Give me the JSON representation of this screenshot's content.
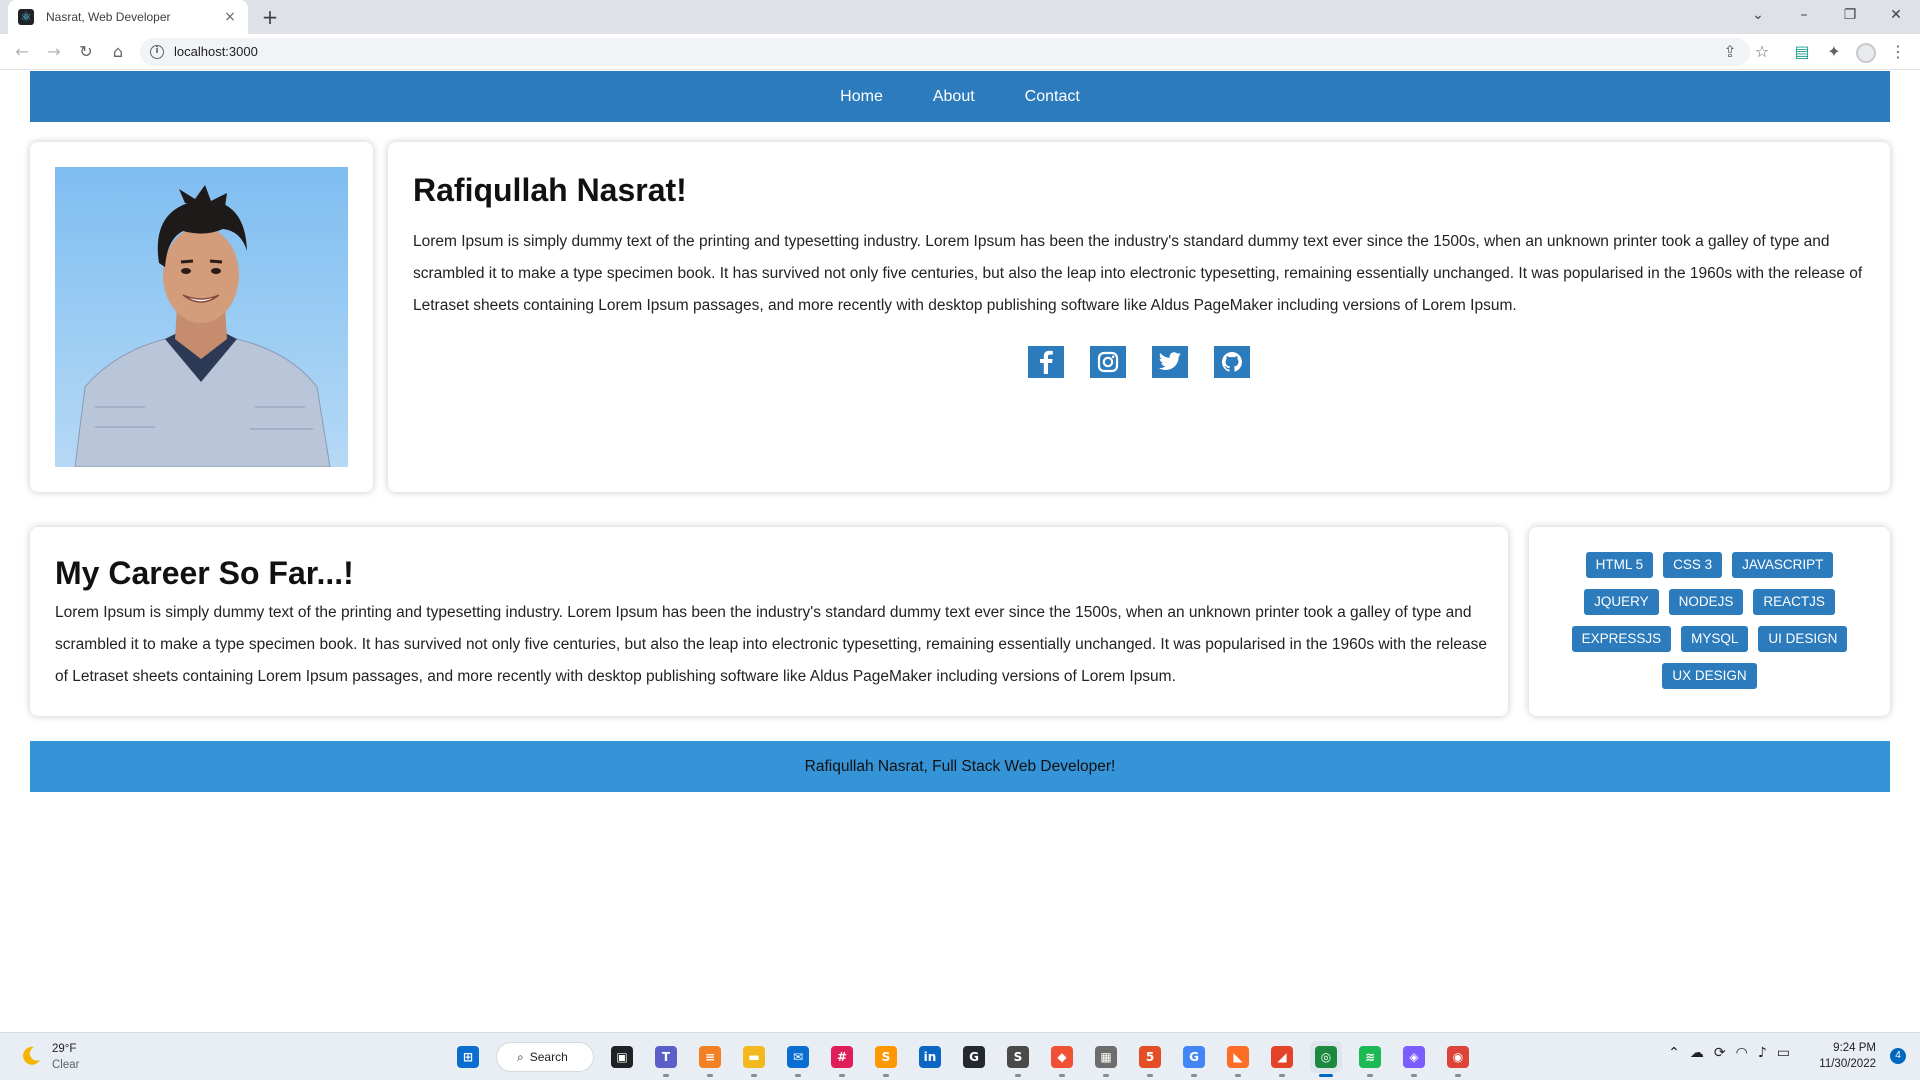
{
  "browser": {
    "tab_title": "Nasrat, Web Developer",
    "favicon_glyph": "⚛",
    "close_glyph": "×",
    "newtab_glyph": "+",
    "url": "localhost:3000",
    "window_controls": {
      "list": "⌄",
      "minimize": "–",
      "restore": "❐",
      "close": "✕"
    },
    "nav_glyphs": {
      "back": "←",
      "forward": "→",
      "reload": "↻",
      "home": "⌂",
      "info": "i",
      "share": "⇪",
      "star": "☆",
      "extensions": "✦",
      "menu": "⋮"
    }
  },
  "site": {
    "nav": [
      "Home",
      "About",
      "Contact"
    ],
    "name": "Rafiqullah Nasrat!",
    "bio": "Lorem Ipsum is simply dummy text of the printing and typesetting industry. Lorem Ipsum has been the industry's standard dummy text ever since the 1500s, when an unknown printer took a galley of type and scrambled it to make a type specimen book. It has survived not only five centuries, but also the leap into electronic typesetting, remaining essentially unchanged. It was popularised in the 1960s with the release of Letraset sheets containing Lorem Ipsum passages, and more recently with desktop publishing software like Aldus PageMaker including versions of Lorem Ipsum.",
    "socials": [
      "facebook-icon",
      "instagram-icon",
      "twitter-icon",
      "github-icon"
    ],
    "career_title": "My Career So Far...!",
    "career_text": "Lorem Ipsum is simply dummy text of the printing and typesetting industry. Lorem Ipsum has been the industry's standard dummy text ever since the 1500s, when an unknown printer took a galley of type and scrambled it to make a type specimen book. It has survived not only five centuries, but also the leap into electronic typesetting, remaining essentially unchanged. It was popularised in the 1960s with the release of Letraset sheets containing Lorem Ipsum passages, and more recently with desktop publishing software like Aldus PageMaker including versions of Lorem Ipsum.",
    "skills": [
      "HTML 5",
      "CSS 3",
      "JAVASCRIPT",
      "JQUERY",
      "NODEJS",
      "REACTJS",
      "EXPRESSJS",
      "MYSQL",
      "UI DESIGN",
      "UX DESIGN"
    ],
    "footer": "Rafiqullah Nasrat, Full Stack Web Developer!",
    "colors": {
      "nav": "#2b7bbd",
      "footer": "#3594d8",
      "skill_badge": "#2b7bbd"
    }
  },
  "taskbar": {
    "weather_temp": "29°F",
    "weather_cond": "Clear",
    "search_label": "Search",
    "search_glyph": "⌕",
    "tray_glyphs": [
      "⌃",
      "☁",
      "⟳",
      "◠",
      "♪",
      "▭"
    ],
    "time": "9:24 PM",
    "date": "11/30/2022",
    "notifications": "4",
    "apps": [
      {
        "name": "windows-start-icon",
        "color": "#0a6ed1",
        "glyph": "⊞"
      },
      {
        "name": "search",
        "color": "",
        "glyph": ""
      },
      {
        "name": "task-view-icon",
        "color": "#202124",
        "glyph": "▣"
      },
      {
        "name": "teams-icon",
        "color": "#5b5fc7",
        "glyph": "T"
      },
      {
        "name": "stackoverflow-icon",
        "color": "#f48024",
        "glyph": "≡"
      },
      {
        "name": "file-explorer-icon",
        "color": "#f2b81e",
        "glyph": "▬"
      },
      {
        "name": "mail-icon",
        "color": "#0a6ed1",
        "glyph": "✉"
      },
      {
        "name": "slack-icon",
        "color": "#e01e5a",
        "glyph": "#"
      },
      {
        "name": "sublime-text-icon",
        "color": "#ff9800",
        "glyph": "S"
      },
      {
        "name": "linkedin-icon",
        "color": "#0a66c2",
        "glyph": "in"
      },
      {
        "name": "github-desktop-icon",
        "color": "#24292e",
        "glyph": "G"
      },
      {
        "name": "sourcetree-icon",
        "color": "#4a4a4a",
        "glyph": "S"
      },
      {
        "name": "git-icon",
        "color": "#f05033",
        "glyph": "◆"
      },
      {
        "name": "app-icon",
        "color": "#6d6d6d",
        "glyph": "▦"
      },
      {
        "name": "html-editor-icon",
        "color": "#e44d26",
        "glyph": "5"
      },
      {
        "name": "google-icon",
        "color": "#4285f4",
        "glyph": "G"
      },
      {
        "name": "gitlab-icon",
        "color": "#fc6d26",
        "glyph": "◣"
      },
      {
        "name": "gitlab-alt-icon",
        "color": "#e24329",
        "glyph": "◢"
      },
      {
        "name": "chrome-canary-icon",
        "color": "#1b8a3e",
        "glyph": "◎"
      },
      {
        "name": "spotify-icon",
        "color": "#1db954",
        "glyph": "≋"
      },
      {
        "name": "app-store-icon",
        "color": "#7a5cff",
        "glyph": "◈"
      },
      {
        "name": "chrome-icon",
        "color": "#db4437",
        "glyph": "◉"
      }
    ]
  }
}
